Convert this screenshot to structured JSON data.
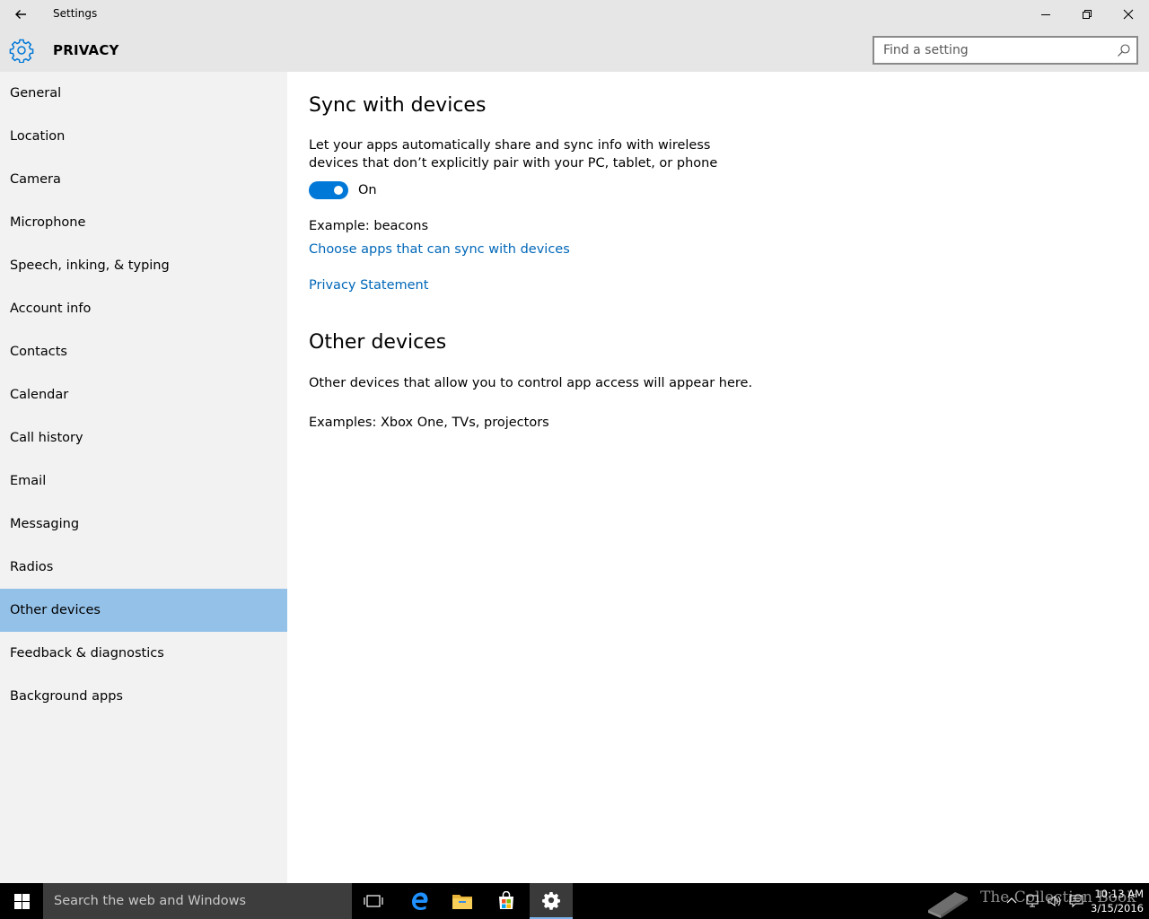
{
  "window": {
    "title": "Settings"
  },
  "header": {
    "section_title": "PRIVACY",
    "search_placeholder": "Find a setting"
  },
  "sidebar": {
    "items": [
      {
        "label": "General"
      },
      {
        "label": "Location"
      },
      {
        "label": "Camera"
      },
      {
        "label": "Microphone"
      },
      {
        "label": "Speech, inking, & typing"
      },
      {
        "label": "Account info"
      },
      {
        "label": "Contacts"
      },
      {
        "label": "Calendar"
      },
      {
        "label": "Call history"
      },
      {
        "label": "Email"
      },
      {
        "label": "Messaging"
      },
      {
        "label": "Radios"
      },
      {
        "label": "Other devices",
        "selected": true
      },
      {
        "label": "Feedback & diagnostics"
      },
      {
        "label": "Background apps"
      }
    ]
  },
  "content": {
    "sync_heading": "Sync with devices",
    "sync_description_line1": "Let your apps automatically share and sync info with wireless",
    "sync_description_line2": "devices that don’t explicitly pair with your PC, tablet, or phone",
    "toggle_state": "On",
    "example_text": "Example: beacons",
    "choose_apps_link": "Choose apps that can sync with devices",
    "privacy_link": "Privacy Statement",
    "other_heading": "Other devices",
    "other_description": "Other devices that allow you to control app access will appear here.",
    "other_examples": "Examples: Xbox One, TVs, projectors"
  },
  "taskbar": {
    "search_placeholder": "Search the web and Windows",
    "watermark_text": "The Collection Book",
    "clock_time": "10:13 AM",
    "clock_date": "3/15/2016"
  },
  "colors": {
    "accent": "#0078d7",
    "link": "#0067b8",
    "selected_nav": "#94c1e8",
    "sidebar_bg": "#f2f2f2",
    "titlebar_bg": "#e6e6e6"
  }
}
